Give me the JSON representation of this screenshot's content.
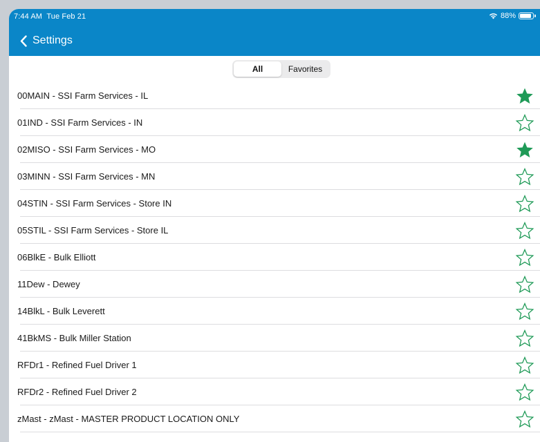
{
  "status_bar": {
    "time": "7:44 AM",
    "date": "Tue Feb 21",
    "battery": "88%",
    "battery_level": 0.88,
    "wifi_icon": "wifi-icon",
    "battery_icon": "battery-icon"
  },
  "nav": {
    "back_label": "Settings",
    "back_icon": "chevron-left-icon"
  },
  "segments": [
    {
      "label": "All",
      "selected": true
    },
    {
      "label": "Favorites",
      "selected": false
    }
  ],
  "locations": [
    {
      "label": "00MAIN - SSI Farm Services - IL",
      "favorite": true
    },
    {
      "label": "01IND - SSI Farm Services - IN",
      "favorite": false
    },
    {
      "label": "02MISO - SSI Farm Services - MO",
      "favorite": true
    },
    {
      "label": "03MINN - SSI Farm Services - MN",
      "favorite": false
    },
    {
      "label": "04STIN - SSI Farm Services - Store IN",
      "favorite": false
    },
    {
      "label": "05STIL - SSI Farm Services - Store IL",
      "favorite": false
    },
    {
      "label": "06BlkE - Bulk Elliott",
      "favorite": false
    },
    {
      "label": "11Dew - Dewey",
      "favorite": false
    },
    {
      "label": "14BlkL - Bulk Leverett",
      "favorite": false
    },
    {
      "label": "41BkMS - Bulk Miller Station",
      "favorite": false
    },
    {
      "label": "RFDr1 - Refined Fuel Driver 1",
      "favorite": false
    },
    {
      "label": "RFDr2 - Refined Fuel Driver 2",
      "favorite": false
    },
    {
      "label": "zMast - zMast - MASTER PRODUCT LOCATION ONLY",
      "favorite": false
    }
  ],
  "colors": {
    "header": "#0a86c8",
    "star": "#1f9a57"
  }
}
